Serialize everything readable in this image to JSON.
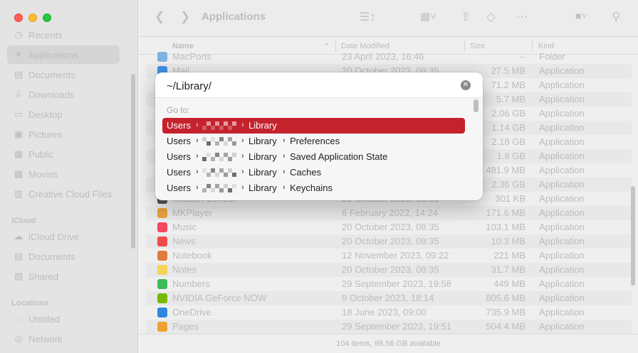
{
  "sidebar": {
    "items": [
      {
        "label": "Recents",
        "icon": "clock-icon"
      },
      {
        "label": "Applications",
        "icon": "applications-icon",
        "active": true
      },
      {
        "label": "Documents",
        "icon": "document-icon"
      },
      {
        "label": "Downloads",
        "icon": "download-icon"
      },
      {
        "label": "Desktop",
        "icon": "desktop-icon"
      },
      {
        "label": "Pictures",
        "icon": "pictures-icon"
      },
      {
        "label": "Public",
        "icon": "public-icon"
      },
      {
        "label": "Movies",
        "icon": "movies-icon"
      },
      {
        "label": "Creative Cloud Files",
        "icon": "creative-cloud-icon"
      }
    ],
    "icloud_title": "iCloud",
    "icloud_items": [
      {
        "label": "iCloud Drive",
        "icon": "cloud-icon"
      },
      {
        "label": "Documents",
        "icon": "document-icon"
      },
      {
        "label": "Shared",
        "icon": "shared-folder-icon"
      }
    ],
    "locations_title": "Locations",
    "locations_items": [
      {
        "label": "Untitled",
        "icon": "disk-icon"
      },
      {
        "label": "Network",
        "icon": "globe-icon"
      }
    ]
  },
  "toolbar": {
    "title": "Applications"
  },
  "columns": {
    "name": "Name",
    "date": "Date Modified",
    "size": "Size",
    "kind": "Kind"
  },
  "rows": [
    {
      "name": "MacPorts",
      "date": "23 April 2023, 16:46",
      "size": "--",
      "kind": "Folder",
      "color": "#7fb3e0"
    },
    {
      "name": "Mail",
      "date": "20 October 2023, 08:35",
      "size": "27.5 MB",
      "kind": "Application",
      "color": "#3d8fe8"
    },
    {
      "name": "",
      "date": "",
      "size": "71.2 MB",
      "kind": "Application",
      "color": ""
    },
    {
      "name": "",
      "date": "",
      "size": "5.7 MB",
      "kind": "Application",
      "color": ""
    },
    {
      "name": "",
      "date": "",
      "size": "2.06 GB",
      "kind": "Application",
      "color": ""
    },
    {
      "name": "",
      "date": "",
      "size": "1.14 GB",
      "kind": "Application",
      "color": ""
    },
    {
      "name": "",
      "date": "",
      "size": "2.18 GB",
      "kind": "Application",
      "color": ""
    },
    {
      "name": "",
      "date": "",
      "size": "1.8 GB",
      "kind": "Application",
      "color": ""
    },
    {
      "name": "",
      "date": "",
      "size": "481.9 MB",
      "kind": "Application",
      "color": ""
    },
    {
      "name": "",
      "date": "",
      "size": "2.36 GB",
      "kind": "Application",
      "color": ""
    },
    {
      "name": "Mission Control",
      "date": "20 October 2023, 08:35",
      "size": "301 KB",
      "kind": "Application",
      "color": "#555555"
    },
    {
      "name": "MKPlayer",
      "date": "6 February 2022, 14:24",
      "size": "171.6 MB",
      "kind": "Application",
      "color": "#e8a23d"
    },
    {
      "name": "Music",
      "date": "20 October 2023, 08:35",
      "size": "103.1 MB",
      "kind": "Application",
      "color": "#f2495e"
    },
    {
      "name": "News",
      "date": "20 October 2023, 08:35",
      "size": "10.3 MB",
      "kind": "Application",
      "color": "#f04a4a"
    },
    {
      "name": "Notebook",
      "date": "12 November 2023, 09:22",
      "size": "221 MB",
      "kind": "Application",
      "color": "#e07a3d"
    },
    {
      "name": "Notes",
      "date": "20 October 2023, 08:35",
      "size": "31.7 MB",
      "kind": "Application",
      "color": "#f5d45a"
    },
    {
      "name": "Numbers",
      "date": "29 September 2023, 19:58",
      "size": "449 MB",
      "kind": "Application",
      "color": "#3dbb5a"
    },
    {
      "name": "NVIDIA GeForce NOW",
      "date": "9 October 2023, 18:14",
      "size": "805.6 MB",
      "kind": "Application",
      "color": "#76b900"
    },
    {
      "name": "OneDrive",
      "date": "18 June 2023, 09:00",
      "size": "735.9 MB",
      "kind": "Application",
      "color": "#2f86e0"
    },
    {
      "name": "Pages",
      "date": "29 September 2023, 19:51",
      "size": "504.4 MB",
      "kind": "Application",
      "color": "#f0a030"
    }
  ],
  "status": "104 items, 98.56 GB available",
  "dialog": {
    "path_value": "~/Library/",
    "goto_label": "Go to:",
    "sep": "›",
    "suggestions": [
      {
        "root": "Users",
        "parts": [
          "Library"
        ],
        "selected": true
      },
      {
        "root": "Users",
        "parts": [
          "Library",
          "Preferences"
        ],
        "selected": false
      },
      {
        "root": "Users",
        "parts": [
          "Library",
          "Saved Application State"
        ],
        "selected": false
      },
      {
        "root": "Users",
        "parts": [
          "Library",
          "Caches"
        ],
        "selected": false
      },
      {
        "root": "Users",
        "parts": [
          "Library",
          "Keychains"
        ],
        "selected": false
      }
    ]
  }
}
